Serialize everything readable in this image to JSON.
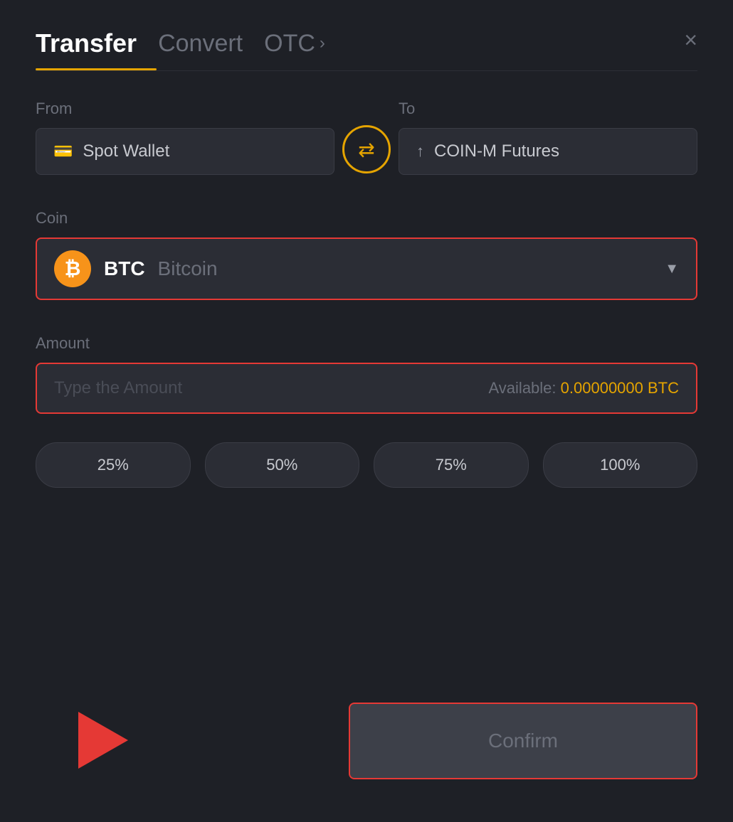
{
  "header": {
    "tab_transfer": "Transfer",
    "tab_convert": "Convert",
    "tab_otc": "OTC",
    "tab_otc_chevron": "›",
    "close_label": "×"
  },
  "from": {
    "label": "From",
    "wallet_name": "Spot Wallet",
    "wallet_icon": "💳"
  },
  "swap": {
    "icon": "⇄"
  },
  "to": {
    "label": "To",
    "wallet_name": "COIN-M Futures",
    "wallet_icon": "↑"
  },
  "coin": {
    "label": "Coin",
    "symbol": "BTC",
    "name": "Bitcoin",
    "icon_letter": "₿"
  },
  "amount": {
    "label": "Amount",
    "placeholder": "Type the Amount",
    "available_label": "Available:",
    "available_value": "0.00000000 BTC"
  },
  "percent_buttons": [
    {
      "label": "25%",
      "value": "25"
    },
    {
      "label": "50%",
      "value": "50"
    },
    {
      "label": "75%",
      "value": "75"
    },
    {
      "label": "100%",
      "value": "100"
    }
  ],
  "confirm": {
    "label": "Confirm"
  }
}
